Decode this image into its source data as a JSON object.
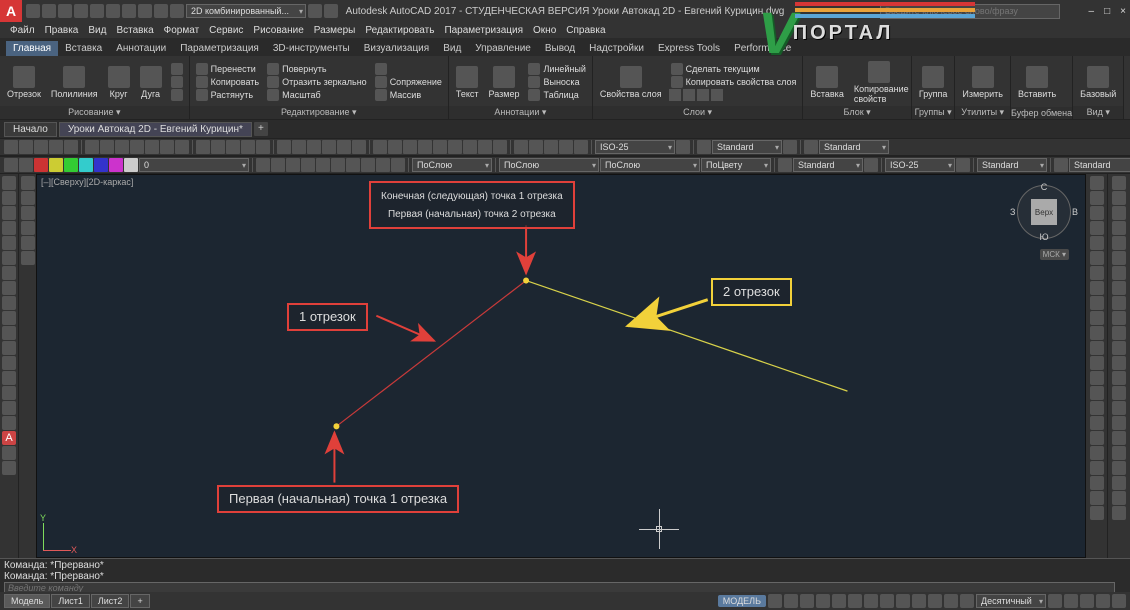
{
  "title": "Autodesk AutoCAD 2017 - СТУДЕНЧЕСКАЯ ВЕРСИЯ   Уроки Автокад 2D - Евгений Курицин.dwg",
  "qat_workspace": "2D комбинированный...",
  "search_placeholder": "Введите ключевое слово/фразу",
  "menus": [
    "Файл",
    "Правка",
    "Вид",
    "Вставка",
    "Формат",
    "Сервис",
    "Рисование",
    "Размеры",
    "Редактировать",
    "Параметризация",
    "Окно",
    "Справка"
  ],
  "ribbon_tabs": [
    "Главная",
    "Вставка",
    "Аннотации",
    "Параметризация",
    "3D-инструменты",
    "Визуализация",
    "Вид",
    "Управление",
    "Вывод",
    "Надстройки",
    "Express Tools",
    "Performance"
  ],
  "ribbon": {
    "draw": {
      "label": "Рисование ▾",
      "items": [
        "Отрезок",
        "Полилиния",
        "Круг",
        "Дуга"
      ]
    },
    "modify": {
      "label": "Редактирование ▾",
      "items": [
        "Перенести",
        "Повернуть",
        "Копировать",
        "Отразить зеркально",
        "Растянуть",
        "Масштаб",
        "Сопряжение",
        "Массив"
      ]
    },
    "annot": {
      "label": "Аннотации ▾",
      "items": [
        "Текст",
        "Размер",
        "Линейный",
        "Выноска",
        "Таблица"
      ]
    },
    "layers": {
      "label": "Слои ▾",
      "items": [
        "Свойства слоя",
        "Сделать текущим",
        "Копировать свойства слоя"
      ]
    },
    "block": {
      "label": "Блок ▾",
      "items": [
        "Вставка",
        "Копирование свойств"
      ]
    },
    "groups": {
      "label": "Группы ▾",
      "item": "Группа"
    },
    "utils": {
      "label": "Утилиты ▾",
      "item": "Измерить"
    },
    "clip": {
      "label": "Буфер обмена",
      "item": "Вставить"
    },
    "view": {
      "label": "Вид ▾",
      "item": "Базовый"
    }
  },
  "doc_tabs": [
    "Начало",
    "Уроки Автокад 2D - Евгений Курицин*"
  ],
  "props": {
    "layer": "ПоСлою",
    "line": "ПоСлою",
    "color": "ПоСлою",
    "lw": "ПоЦвету",
    "dimstyle": "ISO-25",
    "textstyle": "Standard",
    "ts2": "Standard",
    "ts3": "ISO-25",
    "ts4": "Standard",
    "ts5": "Standard",
    "zero": "0"
  },
  "vs_label": "[–][Сверху][2D-каркас]",
  "navcube": {
    "face": "Верх",
    "n": "С",
    "s": "Ю",
    "e": "В",
    "w": "З",
    "wcs": "МСК ▾"
  },
  "annotations": {
    "top": "Конечная (следующая) точка 1 отрезка\nПервая (начальная) точка 2 отрезка",
    "seg1": "1 отрезок",
    "seg2": "2 отрезок",
    "bottom": "Первая (начальная) точка 1 отрезка"
  },
  "cmd": {
    "l1": "Команда: *Прервано*",
    "l2": "Команда:",
    "l3": "Команда: *Прервано*",
    "placeholder": "Введите команду"
  },
  "model_tabs": [
    "Модель",
    "Лист1",
    "Лист2"
  ],
  "status": {
    "model": "МОДЕЛЬ",
    "dec": "Десятичный"
  },
  "portal": "ПОРТАЛ"
}
